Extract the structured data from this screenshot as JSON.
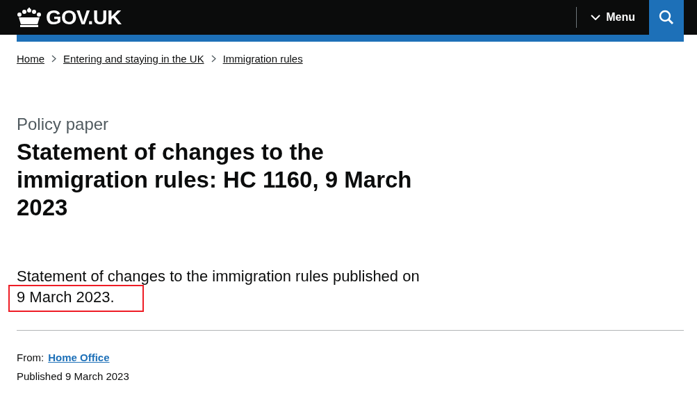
{
  "header": {
    "logo": "GOV.UK",
    "menu_button": "Menu"
  },
  "breadcrumbs": [
    "Home",
    "Entering and staying in the UK",
    "Immigration rules"
  ],
  "caption": "Policy paper",
  "title": "Statement of changes to the immigration rules: HC 1160, 9 March 2023",
  "summary": {
    "text": "Statement of changes to the immigration rules published on",
    "highlighted": "9 March 2023."
  },
  "metadata": {
    "from_label": "From:",
    "from_link": "Home Office",
    "published": "Published 9 March 2023"
  }
}
